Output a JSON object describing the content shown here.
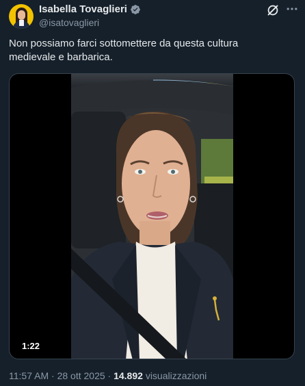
{
  "tweet": {
    "author_name": "Isabella Tovaglieri",
    "author_handle": "@isatovaglieri",
    "text": "Non possiamo farci sottomettere da questa cultura\nmedievale e barbarica.",
    "video_duration": "1:22",
    "time": "11:57 AM",
    "separator": "·",
    "date": "28 ott 2025",
    "views_count": "14.892",
    "views_label": "visualizzazioni"
  },
  "icons": {
    "verified": "verified-badge-icon",
    "grok": "grok-icon",
    "more": "more-icon"
  },
  "colors": {
    "background": "#15202b",
    "verified_blue": "#1d9bf0",
    "avatar_bg": "#f2c200",
    "muted_text": "#8b98a5"
  }
}
